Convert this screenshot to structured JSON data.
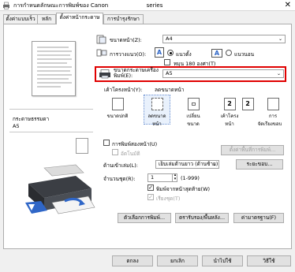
{
  "window": {
    "title": "การกำหนดลักษณะการพิมพ์ของ Canon",
    "title_suffix": "series",
    "close_glyph": "✕"
  },
  "tabs": [
    {
      "label": "ตั้งค่าแบบเร็ว"
    },
    {
      "label": "หลัก"
    },
    {
      "label": "ตั้งค่าหน้ากระดาษ"
    },
    {
      "label": "การบำรุงรักษา"
    }
  ],
  "left": {
    "media_type_label": "กระดาษธรรมดา",
    "media_size": "A5"
  },
  "page_size": {
    "label": "ขนาดหน้า(Z):",
    "value": "A4"
  },
  "orientation": {
    "label": "การวางแนว(O):",
    "portrait_label": "แนวตั้ง",
    "landscape_label": "แนวนอน",
    "rotate_label": "หมุน 180 องศา(T)",
    "icon_letter": "A"
  },
  "printer_paper": {
    "label_line1": "ขนาดกระดาษเครื่อง",
    "label_line2": "พิมพ์(E):",
    "value": "A5"
  },
  "layout": {
    "label": "เค้าโครงหน้า(Y):",
    "current": "ลดขนาดหน้า",
    "options": [
      {
        "label": "ขนาดปกติ",
        "icon_text": ""
      },
      {
        "label": "ลดขนาดหน้า",
        "icon_text": ""
      },
      {
        "label": "เปลี่ยนขนาด",
        "icon_text": ""
      },
      {
        "label": "เค้าโครงหน้า",
        "icon_text": "2"
      },
      {
        "label": "เค้าโครงหน้า",
        "icon_text": "2"
      },
      {
        "label": "การ",
        "label2": "จัดเรียงขอบ",
        "icon_text": ""
      }
    ]
  },
  "duplex": {
    "label": "การพิมพ์สองหน้า(U)",
    "auto_label": "อัตโนมัติ",
    "settings_button": "ตั้งค่าพื้นที่การพิมพ์..."
  },
  "stapling": {
    "label": "ด้านเข้าเล่ม(L):",
    "value": "เย็บเล่มด้านยาว (ด้านซ้าย)",
    "button": "ระยะขอบ..."
  },
  "copies": {
    "label": "จำนวนชุด(R):",
    "value": "1",
    "range": "(1-999)",
    "last_page_label": "พิมพ์จากหน้าสุดท้าย(W)",
    "collate_label": "เรียงชุด(T)"
  },
  "bottom_buttons": {
    "print_options": "ตัวเลือกการพิมพ์...",
    "stamp": "ตรารับรอง/พื้นหลัง...",
    "defaults": "ค่ามาตรฐาน(F)"
  },
  "footer": {
    "ok": "ตกลง",
    "cancel": "ยกเลิก",
    "apply": "นำไปใช้",
    "help": "วิธีใช้"
  }
}
